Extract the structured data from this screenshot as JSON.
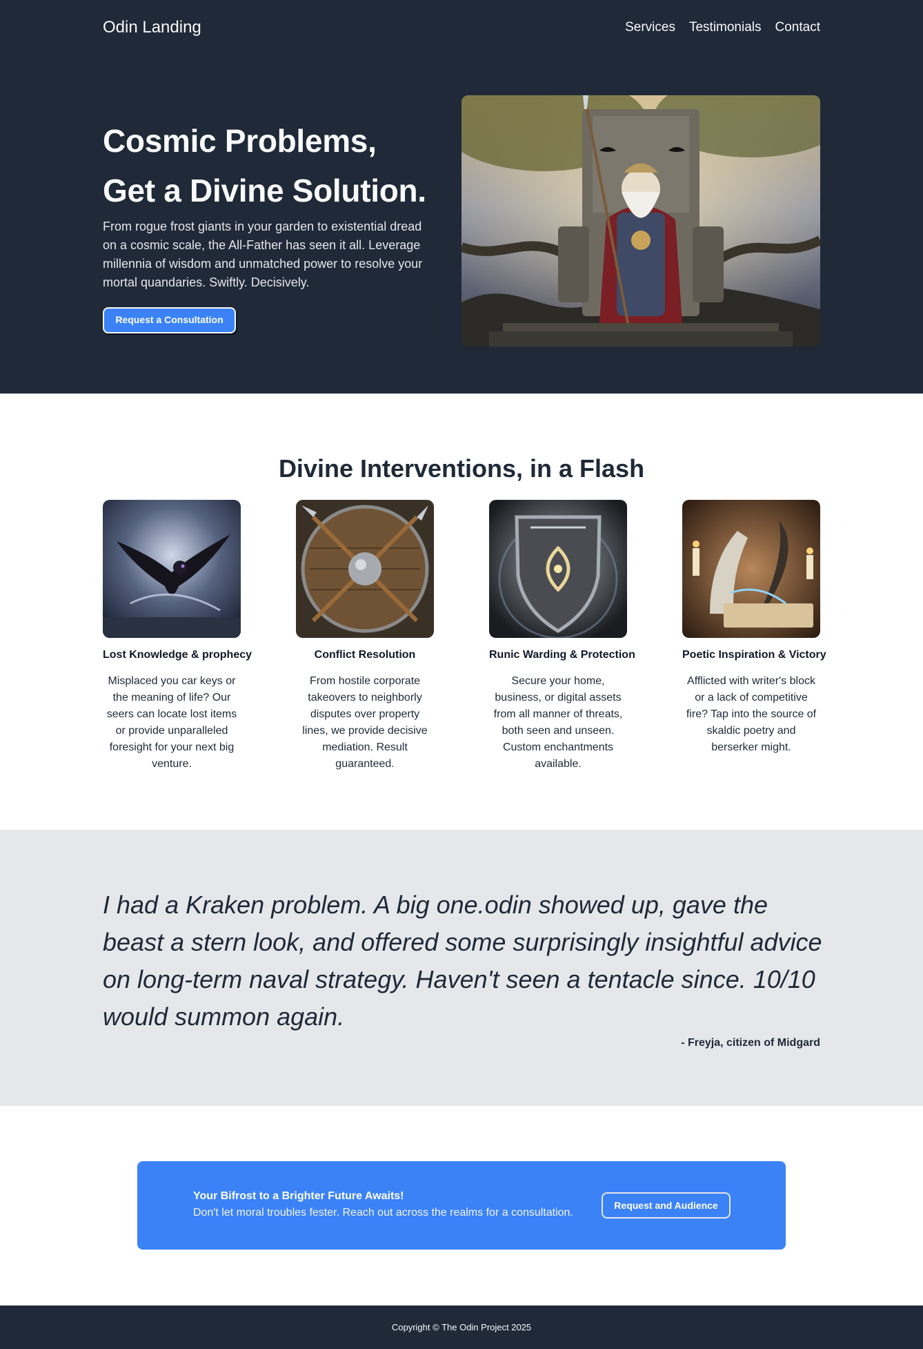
{
  "header": {
    "logo": "Odin Landing",
    "nav": [
      "Services",
      "Testimonials",
      "Contact"
    ]
  },
  "hero": {
    "title_line1": "Cosmic Problems,",
    "title_line2": "Get a Divine Solution.",
    "description": "From rogue frost giants in your garden to existential dread on a cosmic scale, the All-Father has seen it all. Leverage millennia of wisdom and unmatched power to resolve your mortal quandaries. Swiftly. Decisively.",
    "button": "Request a Consultation"
  },
  "services": {
    "title": "Divine Interventions, in a Flash",
    "cards": [
      {
        "title": "Lost Knowledge & prophecy",
        "desc": "Misplaced you car keys or the meaning of life? Our seers can locate lost items or provide unparalleled foresight for your next big venture."
      },
      {
        "title": "Conflict Resolution",
        "desc": "From hostile corporate takeovers to neighborly disputes over property lines, we provide decisive mediation. Result guaranteed."
      },
      {
        "title": "Runic Warding & Protection",
        "desc": "Secure your home, business, or digital assets from all manner of threats, both seen and unseen. Custom enchantments available."
      },
      {
        "title": "Poetic Inspiration & Victory",
        "desc": "Afflicted with writer's block or a lack of competitive fire? Tap into the source of skaldic poetry and berserker might."
      }
    ]
  },
  "testimonial": {
    "quote": "I had a Kraken problem. A big one.odin showed up, gave the beast a stern look, and offered some surprisingly insightful advice on long-term naval strategy. Haven't seen a tentacle since. 10/10 would summon again.",
    "author": "- Freyja, citizen of Midgard"
  },
  "cta": {
    "title": "Your Bifrost to a Brighter Future Awaits!",
    "text": "Don't let moral troubles fester. Reach out across the realms for a consultation.",
    "button": "Request and Audience"
  },
  "footer": {
    "copyright": "Copyright © The Odin Project 2025"
  }
}
